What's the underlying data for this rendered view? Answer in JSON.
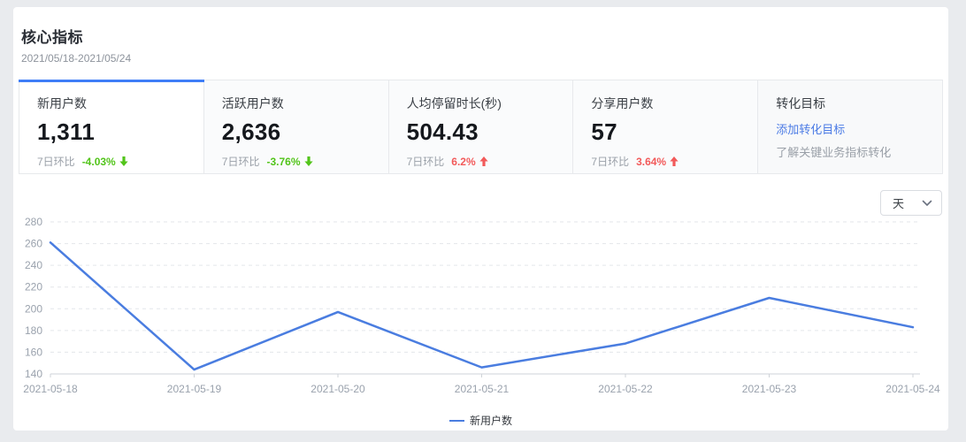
{
  "page": {
    "title": "核心指标",
    "date_range": "2021/05/18-2021/05/24"
  },
  "metric_cards": [
    {
      "label": "新用户数",
      "value": "1,311",
      "compare_label": "7日环比",
      "change": "-4.03%",
      "direction": "down",
      "change_color": "#52c41a",
      "active": true
    },
    {
      "label": "活跃用户数",
      "value": "2,636",
      "compare_label": "7日环比",
      "change": "-3.76%",
      "direction": "down",
      "change_color": "#52c41a",
      "active": false
    },
    {
      "label": "人均停留时长(秒)",
      "value": "504.43",
      "compare_label": "7日环比",
      "change": "6.2%",
      "direction": "up",
      "change_color": "#f25a5a",
      "active": false
    },
    {
      "label": "分享用户数",
      "value": "57",
      "compare_label": "7日环比",
      "change": "3.64%",
      "direction": "up",
      "change_color": "#f25a5a",
      "active": false
    }
  ],
  "goal_card": {
    "title": "转化目标",
    "link_label": "添加转化目标",
    "description": "了解关键业务指标转化"
  },
  "granularity_select": {
    "value": "天"
  },
  "chart_data": {
    "type": "line",
    "title": "",
    "series_name": "新用户数",
    "categories": [
      "2021-05-18",
      "2021-05-19",
      "2021-05-20",
      "2021-05-21",
      "2021-05-22",
      "2021-05-23",
      "2021-05-24"
    ],
    "values": [
      261,
      144,
      197,
      146,
      168,
      210,
      183
    ],
    "ylim": [
      140,
      280
    ],
    "ytick_step": 20,
    "grid": "dashed-horizontal",
    "legend_position": "bottom-center",
    "line_color": "#4a7de0"
  },
  "colors": {
    "accent_blue": "#3f7ef7",
    "link_blue": "#4b7be5",
    "positive_red": "#f25a5a",
    "negative_green": "#52c41a"
  }
}
